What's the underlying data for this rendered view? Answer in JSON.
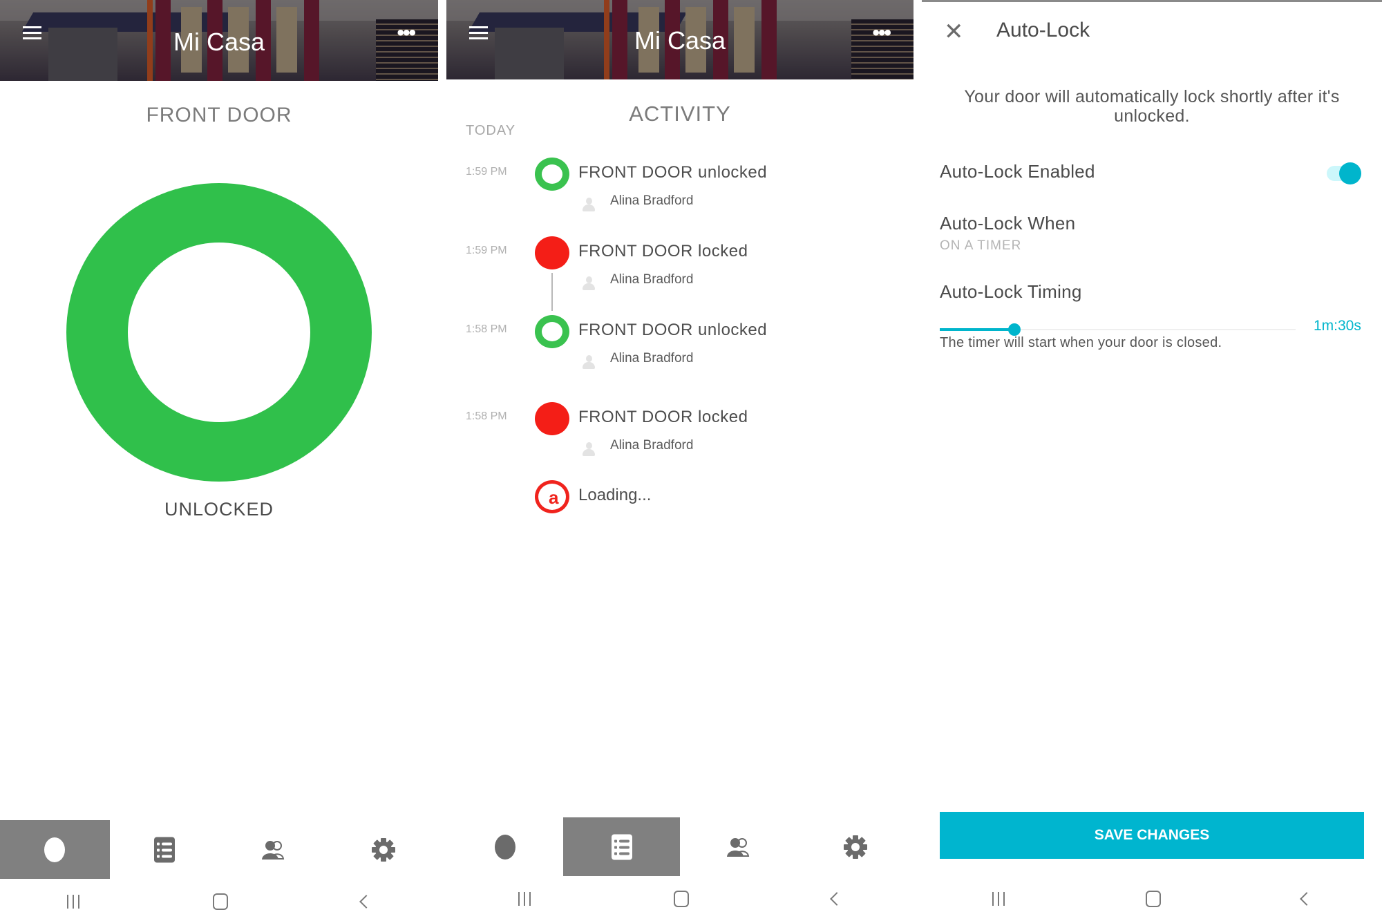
{
  "screens": {
    "lock": {
      "header_title": "Mi Casa",
      "door_name": "FRONT DOOR",
      "lock_state": "UNLOCKED",
      "lock_state_color": "#30c04b",
      "icons": {
        "menu": "hamburger-menu-icon",
        "more": "more-dots-icon"
      },
      "more_glyph": "•••"
    },
    "activity": {
      "header_title": "Mi Casa",
      "title": "ACTIVITY",
      "section": "TODAY",
      "events": [
        {
          "time": "1:59 PM",
          "text": "FRONT DOOR unlocked",
          "user": "Alina Bradford",
          "state": "unlocked"
        },
        {
          "time": "1:59 PM",
          "text": "FRONT DOOR locked",
          "user": "Alina Bradford",
          "state": "locked"
        },
        {
          "time": "1:58 PM",
          "text": "FRONT DOOR unlocked",
          "user": "Alina Bradford",
          "state": "unlocked"
        },
        {
          "time": "1:58 PM",
          "text": "FRONT DOOR locked",
          "user": "Alina Bradford",
          "state": "locked"
        }
      ],
      "loading_text": "Loading...",
      "loading_glyph": "a",
      "colors": {
        "unlocked": "#3ac24f",
        "locked": "#f41e17"
      },
      "more_glyph": "•••"
    },
    "autolock": {
      "close_glyph": "✕",
      "title": "Auto-Lock",
      "description": "Your door will automatically lock shortly after it's unlocked.",
      "enabled_label": "Auto-Lock Enabled",
      "enabled": true,
      "when_label": "Auto-Lock When",
      "when_value": "ON A TIMER",
      "timing_label": "Auto-Lock Timing",
      "timing_value": "1m:30s",
      "timing_fraction": 0.21,
      "timing_hint": "The timer will start when your door is closed.",
      "save_label": "SAVE CHANGES",
      "accent_color": "#00b5cf"
    }
  },
  "bottom_nav": {
    "tabs": [
      {
        "name": "lock-status",
        "icon": "lock-status-dot-icon"
      },
      {
        "name": "activity",
        "icon": "activity-list-icon"
      },
      {
        "name": "users",
        "icon": "users-icon"
      },
      {
        "name": "settings",
        "icon": "gear-icon"
      }
    ],
    "active_on_lock_screen": "lock-status",
    "active_on_activity_screen": "activity"
  },
  "system_nav": {
    "recents": "recents-icon",
    "home": "home-icon",
    "back": "back-icon"
  }
}
